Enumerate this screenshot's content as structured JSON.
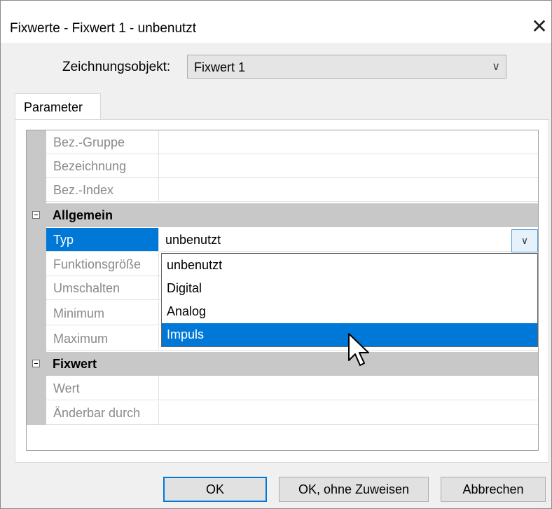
{
  "window": {
    "title": "Fixwerte - Fixwert 1 - unbenutzt",
    "close_glyph": "✕"
  },
  "zeichnungsobjekt": {
    "label": "Zeichnungsobjekt:",
    "value": "Fixwert 1",
    "arrow": "∨"
  },
  "tab": {
    "label": "Parameter"
  },
  "grid": {
    "rows_top": [
      "Bez.-Gruppe",
      "Bezeichnung",
      "Bez.-Index"
    ],
    "category_allgemein": "Allgemein",
    "typ": {
      "name": "Typ",
      "value": "unbenutzt",
      "arrow": "∨"
    },
    "rows_allgemein": [
      "Funktionsgröße",
      "Umschalten",
      "Minimum",
      "Maximum"
    ],
    "category_fixwert": "Fixwert",
    "rows_fixwert": [
      "Wert",
      "Änderbar durch"
    ]
  },
  "dropdown": {
    "options": [
      "unbenutzt",
      "Digital",
      "Analog",
      "Impuls"
    ],
    "selected": "Impuls"
  },
  "buttons": {
    "ok": "OK",
    "ok_no_assign": "OK, ohne Zuweisen",
    "cancel": "Abbrechen"
  },
  "colors": {
    "selection": "#0078d7",
    "category_bg": "#c8c8c8"
  }
}
